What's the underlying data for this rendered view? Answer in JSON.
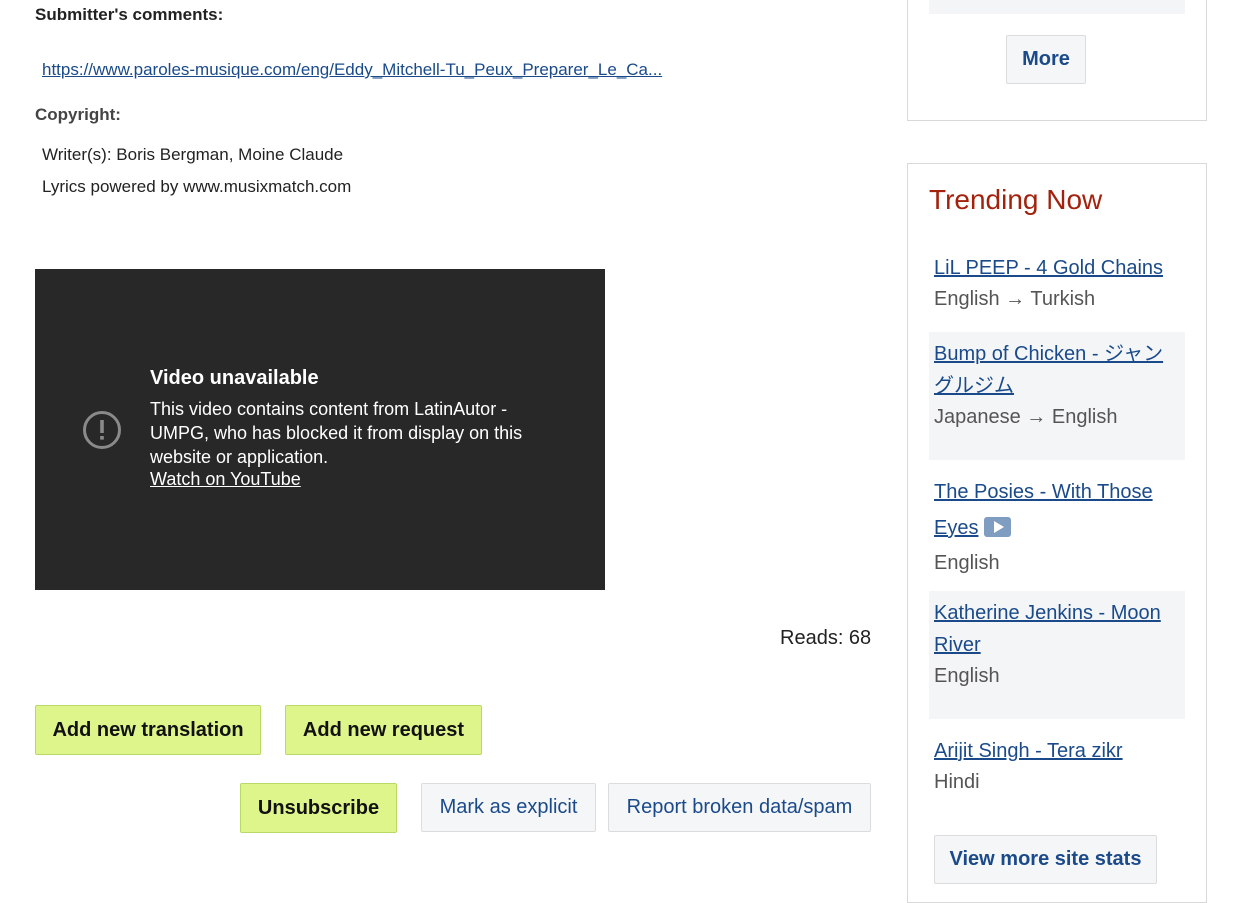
{
  "main": {
    "submitter_label": "Submitter's comments:",
    "source_link": "https://www.paroles-musique.com/eng/Eddy_Mitchell-Tu_Peux_Preparer_Le_Ca...",
    "copyright_label": "Copyright:",
    "writers": "Writer(s): Boris Bergman, Moine Claude",
    "powered_by": "Lyrics powered by www.musixmatch.com",
    "video": {
      "title": "Video unavailable",
      "message_line1": "This video contains content from LatinAutor -",
      "message_line2": "UMPG, who has blocked it from display on this",
      "message_line3": "website or application.",
      "watch_link": "Watch on YouTube",
      "warning_icon": "exclamation-circle-icon"
    },
    "reads": "Reads: 68",
    "buttons": {
      "add_translation": "Add new translation",
      "add_request": "Add new request",
      "unsubscribe": "Unsubscribe",
      "mark_explicit": "Mark as explicit",
      "report_broken": "Report broken data/spam"
    }
  },
  "sidebar": {
    "more_button": "More",
    "trending_title": "Trending Now",
    "items": [
      {
        "title": "LiL PEEP - 4 Gold Chains",
        "lang": "English → Turkish"
      },
      {
        "title_line1": "Bump of Chicken - ジャン",
        "title_line2": "グルジム",
        "lang": "Japanese → English"
      },
      {
        "title_line1": "The Posies - With Those",
        "title_line2": "Eyes",
        "lang": "English",
        "icon": "video-play-icon"
      },
      {
        "title_line1": "Katherine Jenkins - Moon",
        "title_line2": "River",
        "lang": "English"
      },
      {
        "title": "Arijit Singh - Tera zikr",
        "lang": "Hindi"
      }
    ],
    "view_stats_button": "View more site stats"
  },
  "colors": {
    "accent_green": "#ddf58a",
    "link_blue": "#1a4a8a",
    "trending_red": "#a2220e",
    "video_bg": "#282828"
  }
}
